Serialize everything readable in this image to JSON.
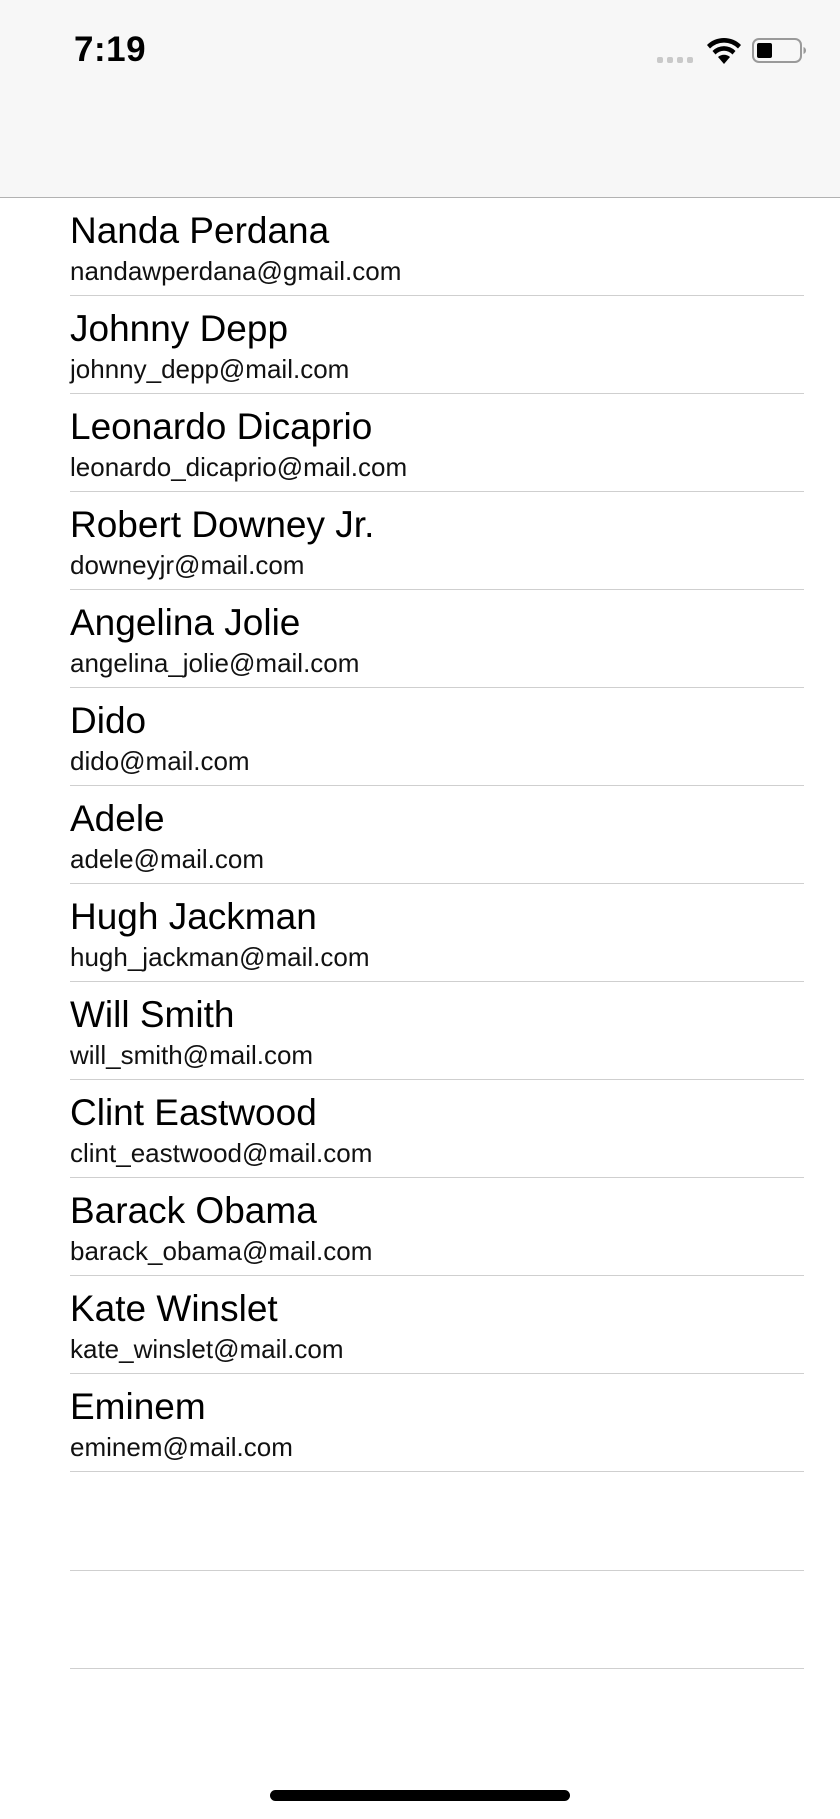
{
  "status_bar": {
    "time": "7:19"
  },
  "contacts": [
    {
      "name": "Nanda Perdana",
      "email": "nandawperdana@gmail.com"
    },
    {
      "name": "Johnny Depp",
      "email": "johnny_depp@mail.com"
    },
    {
      "name": "Leonardo Dicaprio",
      "email": "leonardo_dicaprio@mail.com"
    },
    {
      "name": "Robert Downey Jr.",
      "email": "downeyjr@mail.com"
    },
    {
      "name": "Angelina Jolie",
      "email": "angelina_jolie@mail.com"
    },
    {
      "name": "Dido",
      "email": "dido@mail.com"
    },
    {
      "name": "Adele",
      "email": "adele@mail.com"
    },
    {
      "name": "Hugh Jackman",
      "email": "hugh_jackman@mail.com"
    },
    {
      "name": "Will Smith",
      "email": "will_smith@mail.com"
    },
    {
      "name": "Clint Eastwood",
      "email": "clint_eastwood@mail.com"
    },
    {
      "name": "Barack Obama",
      "email": "barack_obama@mail.com"
    },
    {
      "name": "Kate Winslet",
      "email": "kate_winslet@mail.com"
    },
    {
      "name": "Eminem",
      "email": "eminem@mail.com"
    }
  ]
}
